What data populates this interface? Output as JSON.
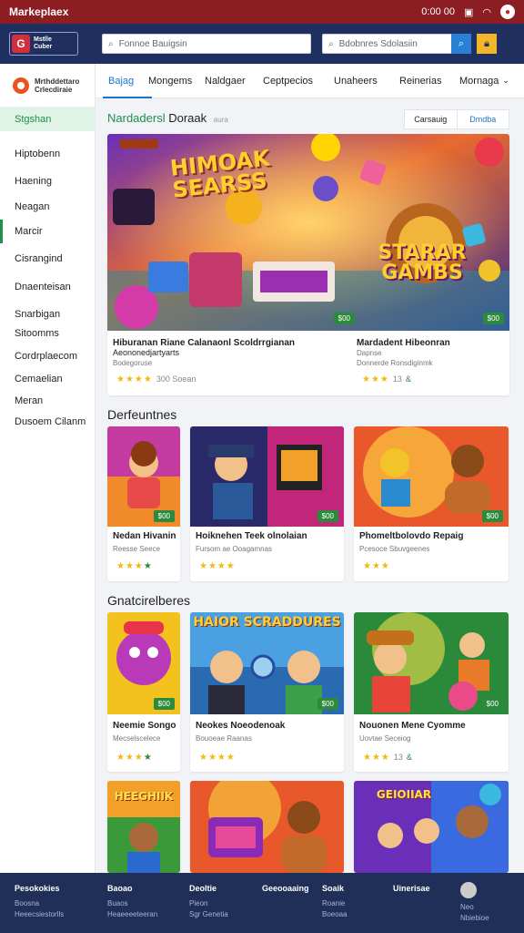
{
  "statusbar": {
    "app_name": "Markeplaex",
    "time": "0:00 00",
    "icons": [
      "screenshot-icon",
      "wifi-icon",
      "record-icon"
    ]
  },
  "topbar": {
    "logo_text": [
      "Mstlle",
      "Cuber"
    ],
    "search1_placeholder": "Fonnoe Bauigsin",
    "search2_placeholder": "Bdobnres Sdolasiin"
  },
  "sidebar": {
    "logo_text": [
      "Mrthddettaro",
      "Crlecdiraie"
    ],
    "items": [
      "Stgshan",
      "Hiptobenn",
      "Haening",
      "Neagan",
      "Marcir",
      "Cisrangind",
      "Dnaenteisan",
      "Snarbigan",
      "Sitoomms",
      "Cordrplaecom",
      "Cemaelian",
      "Meran",
      "Dusoem Cilanm"
    ]
  },
  "tabs": [
    "Bajag",
    "Mongems",
    "Naldgaer",
    "Ceptpecios",
    "Unaheers",
    "Reinerias",
    "Mornaga"
  ],
  "featured": {
    "title_green": "Nardadersl",
    "title_dark": "Doraak",
    "title_small": "aura",
    "sort_left": "Carsauig",
    "sort_right": "Dmdba",
    "cards": [
      {
        "title": "Hiburanan Riane Calanaonl Scoldrrgianan",
        "subtitle": "Aeononedjartyarts",
        "meta": "Bodegoruse",
        "rating_text": "300 Soean",
        "stars": 4,
        "price": "$00",
        "heading": "HIMOAK SEARSS"
      },
      {
        "title": "Mardadent Hibeonran",
        "subtitle": "Dapnse",
        "meta": "Donnerde Ronsdiginmk",
        "rating_text": "13",
        "rating_pct": "&",
        "stars": 3,
        "price": "$00",
        "heading": "STARAR GAMBS"
      }
    ]
  },
  "section2": {
    "title": "Derfeuntnes",
    "cards": [
      {
        "title": "Nedan Hivanin",
        "subtitle": "Reesse Seece",
        "stars": 4,
        "price": "$00"
      },
      {
        "title": "Hoiknehen Teek olnolaian",
        "subtitle": "Fursom ae Ooagamnas",
        "stars": 4,
        "price": "$00"
      },
      {
        "title": "Phomeltbolovdo Repaig",
        "subtitle": "Pcesoce Sbuvgeenes",
        "stars": 4,
        "price": "$00"
      }
    ]
  },
  "section3": {
    "title": "Gnatcirelberes",
    "cards": [
      {
        "title": "Neemie Songo",
        "subtitle": "Mecselscelece",
        "stars": 4,
        "price": "$00"
      },
      {
        "title": "Neokes Noeodenoak",
        "subtitle": "Bouoeae Raanas",
        "stars": 4,
        "price": "$00",
        "heading": "HAIOR SCRADDURES"
      },
      {
        "title": "Nouonen Mene Cyomme",
        "subtitle": "Uovtae Seceiog",
        "rating_text": "13",
        "rating_pct": "&",
        "stars": 3,
        "price": "$00"
      }
    ]
  },
  "section4": {
    "cards": [
      {
        "heading": "HEEGHIIK"
      },
      {
        "heading": ""
      },
      {
        "heading": "GEIOIIAR"
      }
    ]
  },
  "footer": {
    "cols": [
      {
        "head": "Pesokokies",
        "links": [
          "Boosna",
          "Heeecsiestorlls"
        ]
      },
      {
        "head": "Baoao",
        "links": [
          "Buaos",
          "Heaeeeeteeran"
        ]
      },
      {
        "head": "Deoltie",
        "links": [
          "Pieon",
          "Sgr Genetia"
        ]
      },
      {
        "head": "Geeooaaing",
        "links": []
      },
      {
        "head": "Soaik",
        "links": [
          "Roanie",
          "Boeoaa"
        ]
      },
      {
        "head": "Uinerisae",
        "links": []
      },
      {
        "head": "",
        "links": [
          "Neo",
          "Nbiebioe"
        ]
      }
    ]
  }
}
